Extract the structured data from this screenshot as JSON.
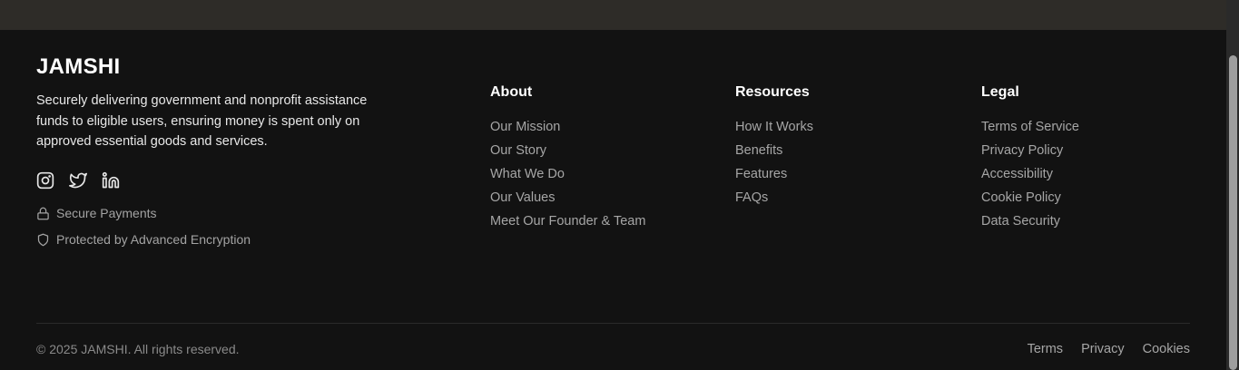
{
  "brand": {
    "name": "JAMSHI",
    "description": "Securely delivering government and nonprofit assistance funds to eligible users, ensuring money is spent only on approved essential goods and services."
  },
  "socials": [
    {
      "icon": "instagram-icon"
    },
    {
      "icon": "twitter-icon"
    },
    {
      "icon": "linkedin-icon"
    }
  ],
  "badges": {
    "secure_payments": "Secure Payments",
    "encryption": "Protected by Advanced Encryption"
  },
  "about": {
    "heading": "About",
    "links": [
      "Our Mission",
      "Our Story",
      "What We Do",
      "Our Values",
      "Meet Our Founder & Team"
    ]
  },
  "resources": {
    "heading": "Resources",
    "links": [
      "How It Works",
      "Benefits",
      "Features",
      "FAQs"
    ]
  },
  "legal": {
    "heading": "Legal",
    "links": [
      "Terms of Service",
      "Privacy Policy",
      "Accessibility",
      "Cookie Policy",
      "Data Security"
    ]
  },
  "bottom": {
    "copyright": "© 2025 JAMSHI. All rights reserved.",
    "links": [
      "Terms",
      "Privacy",
      "Cookies"
    ]
  },
  "colors": {
    "background": "#121212",
    "top_band": "#2e2c28",
    "heading": "#ffffff",
    "link": "#a6a6a6"
  }
}
